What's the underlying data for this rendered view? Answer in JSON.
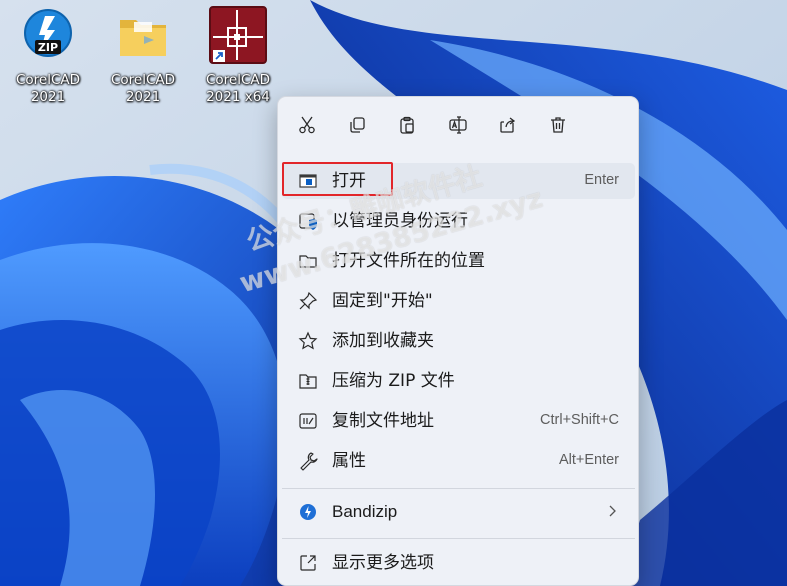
{
  "desktop": {
    "icons": [
      {
        "name": "zip-app",
        "label": "CorelCAD\n2021",
        "icon": "zip-icon"
      },
      {
        "name": "folder",
        "label": "CorelCAD\n2021",
        "icon": "folder-icon"
      },
      {
        "name": "corelcad-shortcut",
        "label": "CorelCAD\n2021 x64",
        "icon": "corelcad-icon"
      }
    ],
    "zip_badge": "ZIP"
  },
  "watermark": {
    "line1": "公众号：雕咖软件社",
    "line2": "www.628385222.xyz"
  },
  "colors": {
    "accent": "#0a5fc4",
    "highlight_border": "#e2262a",
    "menu_bg": "#eef1f7"
  },
  "toolbar": [
    {
      "name": "cut",
      "icon": "scissors-icon"
    },
    {
      "name": "copy",
      "icon": "copy-icon"
    },
    {
      "name": "paste",
      "icon": "paste-icon"
    },
    {
      "name": "rename",
      "icon": "rename-icon"
    },
    {
      "name": "share",
      "icon": "share-icon"
    },
    {
      "name": "delete",
      "icon": "trash-icon"
    }
  ],
  "menu": {
    "items": [
      {
        "label": "打开",
        "shortcut": "Enter",
        "icon": "open-window-icon"
      },
      {
        "label": "以管理员身份运行",
        "shortcut": "",
        "icon": "admin-shield-icon"
      },
      {
        "label": "打开文件所在的位置",
        "shortcut": "",
        "icon": "folder-outline-icon"
      },
      {
        "label": "固定到\"开始\"",
        "shortcut": "",
        "icon": "pin-icon"
      },
      {
        "label": "添加到收藏夹",
        "shortcut": "",
        "icon": "star-icon"
      },
      {
        "label": "压缩为 ZIP 文件",
        "shortcut": "",
        "icon": "zip-folder-icon"
      },
      {
        "label": "复制文件地址",
        "shortcut": "Ctrl+Shift+C",
        "icon": "copy-path-icon"
      },
      {
        "label": "属性",
        "shortcut": "Alt+Enter",
        "icon": "wrench-icon"
      }
    ],
    "bandizip": {
      "label": "Bandizip",
      "icon": "bandizip-icon"
    },
    "more": {
      "label": "显示更多选项",
      "icon": "more-options-icon"
    }
  }
}
